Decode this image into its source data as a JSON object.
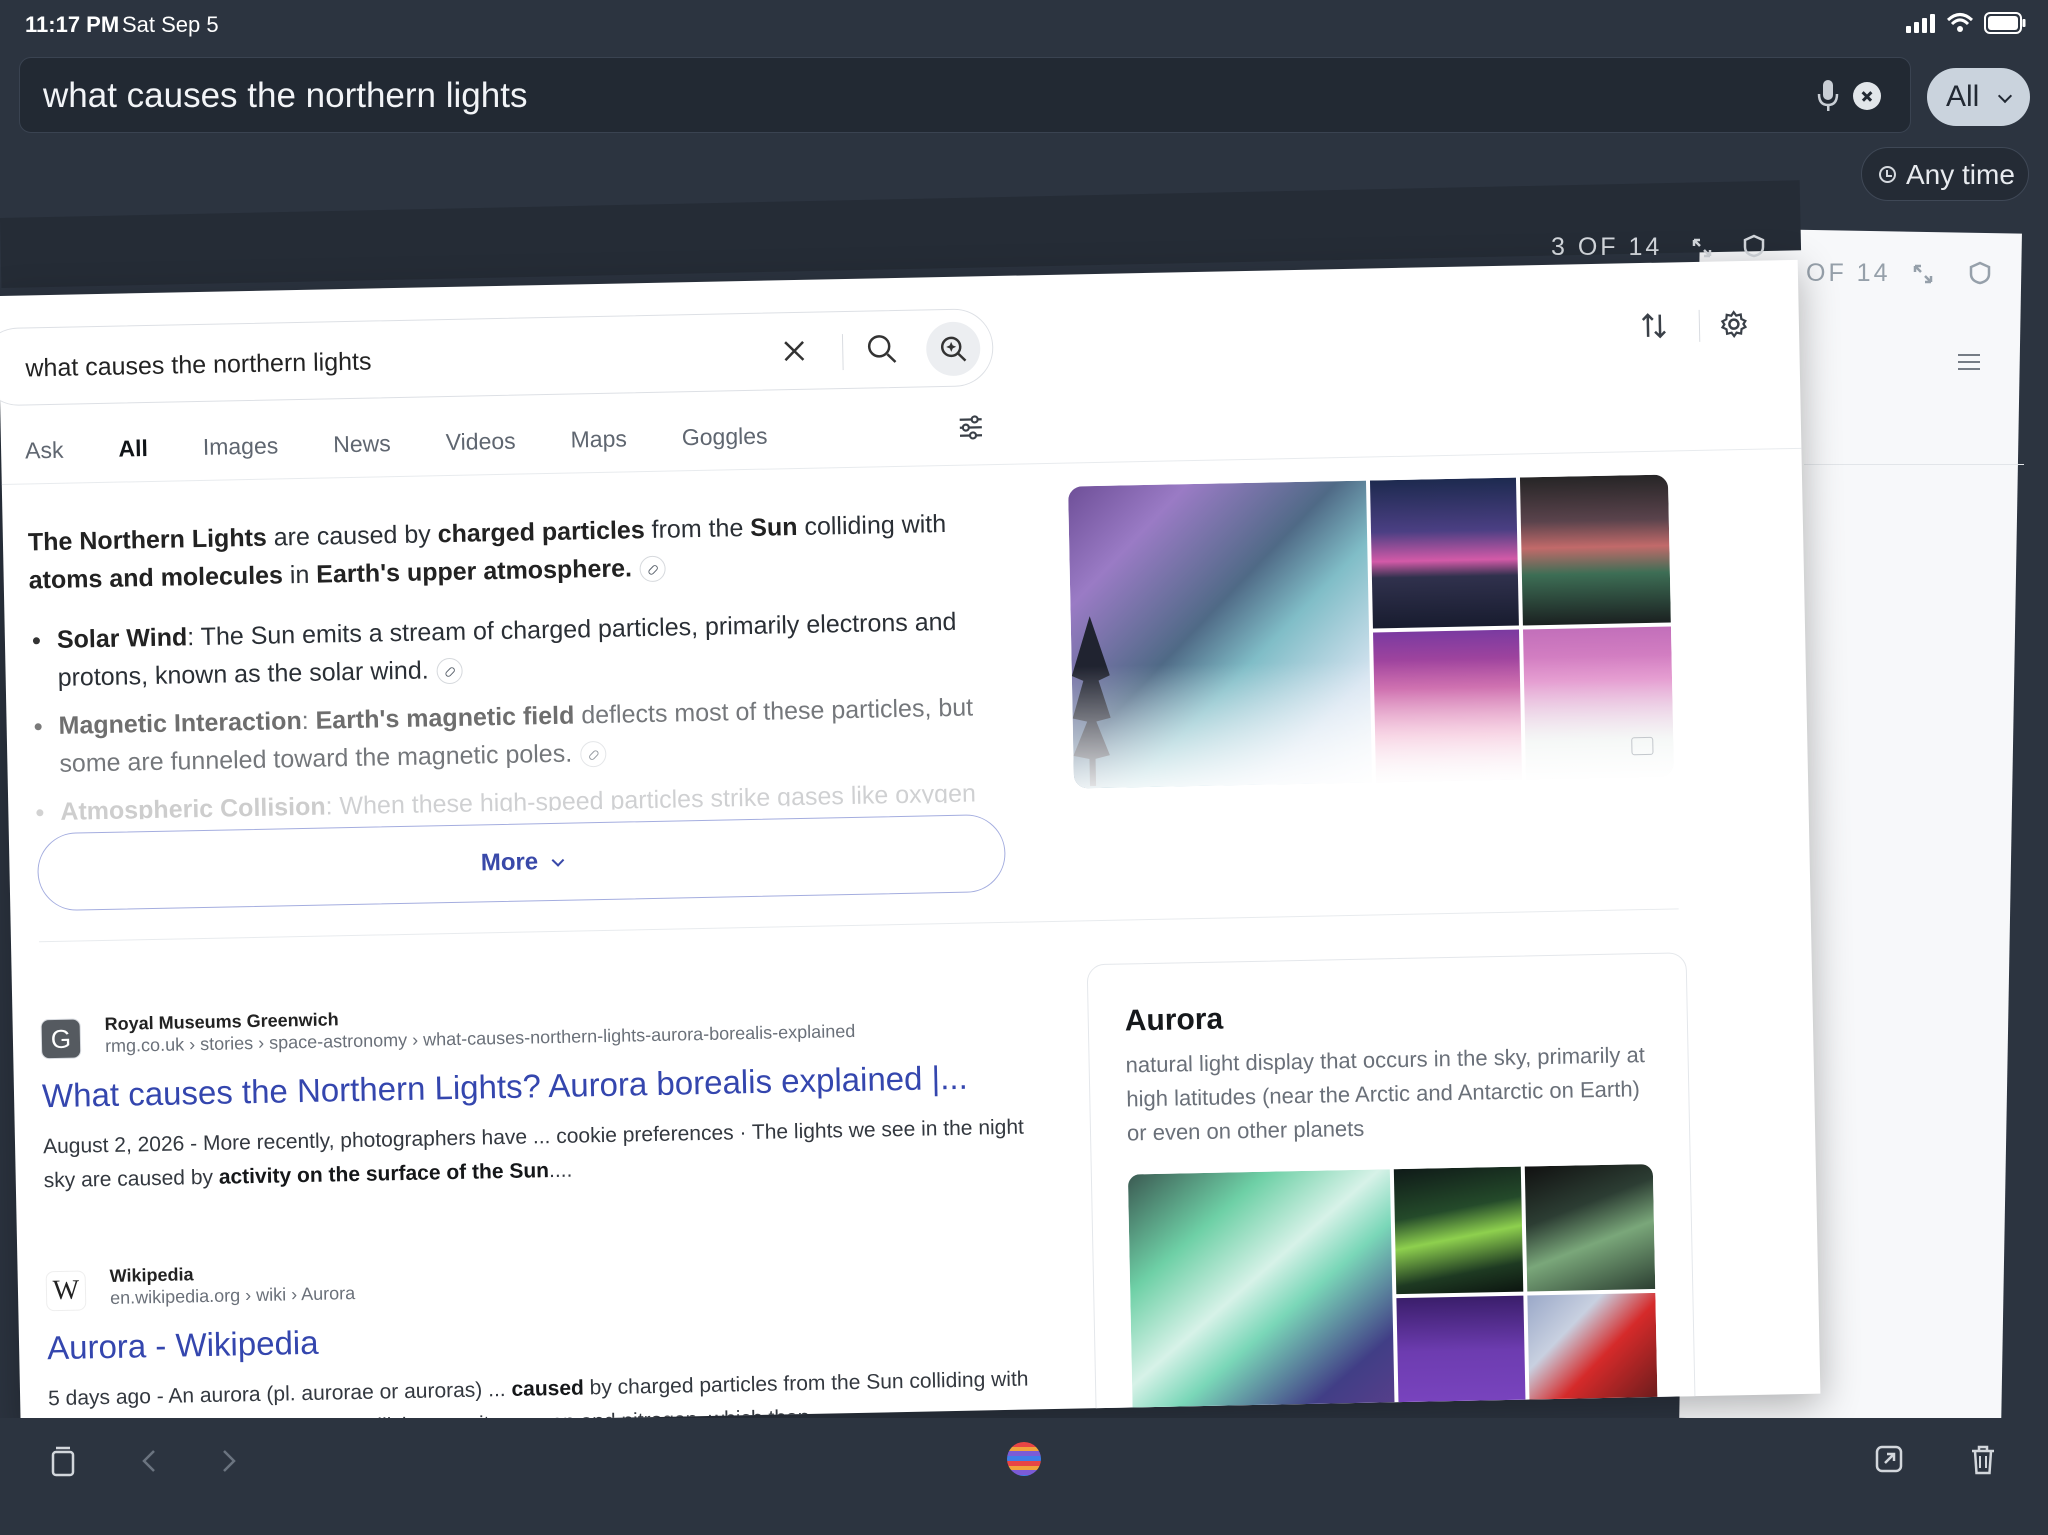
{
  "status": {
    "time": "11:17 PM",
    "date": "Sat Sep 5"
  },
  "top_search": {
    "query": "what causes the northern lights",
    "scope": "All",
    "time_filter": "Any time"
  },
  "tab_counter": {
    "current": "3 OF 14",
    "back": "OF 14"
  },
  "page": {
    "search_query": "what causes the northern lights",
    "tabs": [
      {
        "label": "Ask"
      },
      {
        "label": "All"
      },
      {
        "label": "Images"
      },
      {
        "label": "News"
      },
      {
        "label": "Videos"
      },
      {
        "label": "Maps"
      },
      {
        "label": "Goggles"
      }
    ],
    "summary": {
      "lead_1": "The Northern Lights",
      "lead_2": " are caused by ",
      "lead_3": "charged particles",
      "lead_4": " from the ",
      "lead_5": "Sun",
      "lead_6": " colliding with ",
      "lead_7": "atoms and molecules",
      "lead_8": " in ",
      "lead_9": "Earth's upper atmosphere.",
      "bullet1_term": "Solar Wind",
      "bullet1_text": ": The Sun emits a stream of charged particles, primarily electrons and protons, known as the solar wind.",
      "bullet2_term": "Magnetic Interaction",
      "bullet2_mid": ": ",
      "bullet2_bold": "Earth's magnetic field",
      "bullet2_text": " deflects most of these particles, but some are funneled toward the magnetic poles.",
      "bullet3_term": "Atmospheric Collision",
      "bullet3_text": ": When these high-speed particles strike gases like oxygen"
    },
    "more_label": "More",
    "results": [
      {
        "site": "Royal Museums Greenwich",
        "url": "rmg.co.uk › stories › space-astronomy › what-causes-northern-lights-aurora-borealis-explained",
        "title": "What causes the Northern Lights? Aurora borealis explained |...",
        "snippet_1": "August 2, 2026 - More recently, photographers have ... cookie preferences · The lights we see in the night sky are caused by ",
        "snippet_bold": "activity on the surface of the Sun",
        "snippet_2": "....",
        "favicon": "G"
      },
      {
        "site": "Wikipedia",
        "url": "en.wikipedia.org › wiki › Aurora",
        "title": "Aurora - Wikipedia",
        "snippet_1": "5 days ago - An aurora (pl. aurorae or auroras) ... ",
        "snippet_bold": "caused",
        "snippet_2": " by charged particles from the Sun colliding with atoms in the atmosphere. These collisions excite oxygen and nitrogen, which then...",
        "favicon": "W"
      }
    ],
    "knowledge": {
      "title": "Aurora",
      "description": "natural light display that occurs in the sky, primarily at high latitudes (near the Arctic and Antarctic on Earth) or even on other planets"
    }
  },
  "colors": {
    "chrome": "#2c3440",
    "link": "#3446ae",
    "more_border": "#a4addf"
  }
}
